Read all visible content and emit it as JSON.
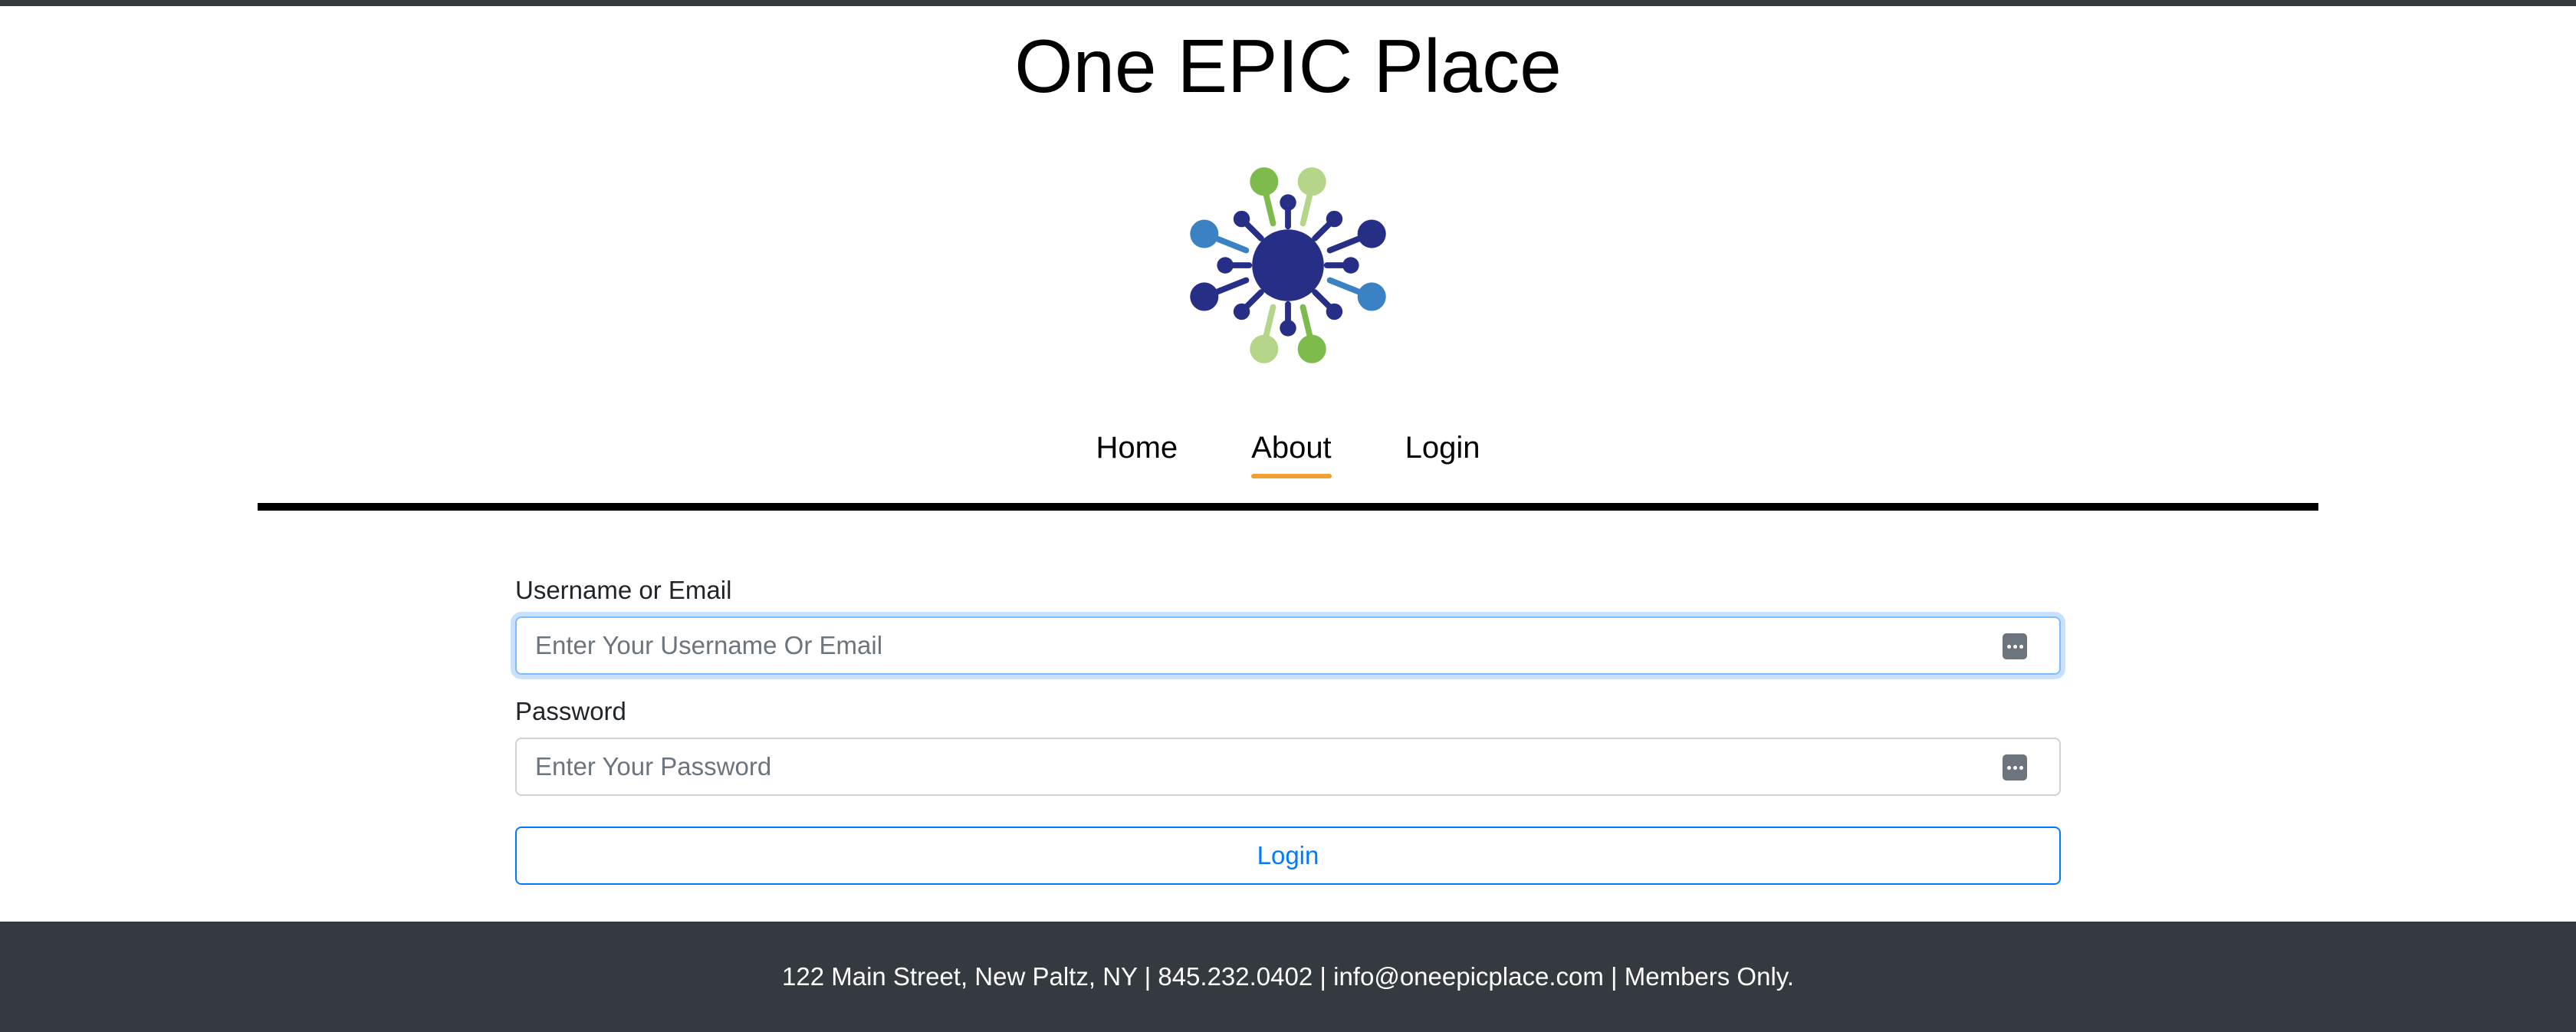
{
  "header": {
    "title": "One EPIC Place"
  },
  "logo": {
    "icon": "network-hub-logo",
    "colors": {
      "navy": "#262f85",
      "blue": "#3b82c4",
      "green": "#7dbb4c",
      "light_green": "#b5d68a"
    }
  },
  "nav": {
    "items": [
      {
        "label": "Home",
        "active": false
      },
      {
        "label": "About",
        "active": true
      },
      {
        "label": "Login",
        "active": false
      }
    ],
    "active_underline_color": "#f0a030"
  },
  "form": {
    "username": {
      "label": "Username or Email",
      "placeholder": "Enter Your Username Or Email",
      "value": ""
    },
    "password": {
      "label": "Password",
      "placeholder": "Enter Your Password",
      "value": ""
    },
    "submit_label": "Login",
    "accent_color": "#007bff"
  },
  "footer": {
    "text": "122 Main Street, New Paltz, NY | 845.232.0402 | info@oneepicplace.com | Members Only."
  }
}
